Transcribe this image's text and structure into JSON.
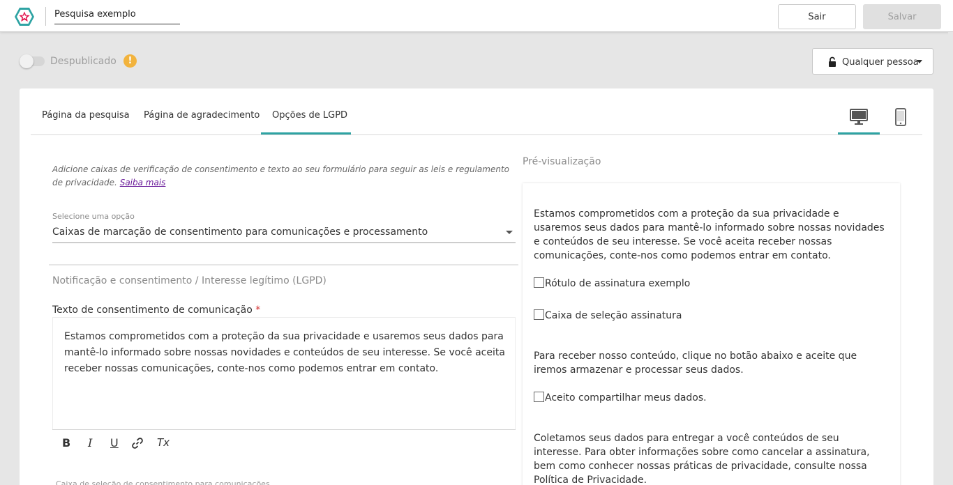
{
  "header": {
    "survey_title": "Pesquisa exemplo",
    "exit_label": "Sair",
    "save_label": "Salvar"
  },
  "status": {
    "publish_label": "Despublicado",
    "warning_glyph": "!",
    "access_label": "Qualquer pessoa"
  },
  "tabs": [
    {
      "label": "Página da pesquisa"
    },
    {
      "label": "Página de agradecimento"
    },
    {
      "label": "Opções de LGPD"
    }
  ],
  "active_tab": "Opções de LGPD",
  "devices": {
    "selected": "desktop-icon",
    "other": "mobile-icon"
  },
  "form": {
    "intro_text": "Adicione caixas de verificação de consentimento e texto ao seu formulário para seguir as leis e regulamento de privacidade.",
    "learn_more": "Saiba mais",
    "select_label": "Selecione uma opção",
    "select_value": "Caixas de marcação de consentimento para comunicações e processamento",
    "section_title": "Notificação e consentimento / Interesse legítimo (LGPD)",
    "consent_label": "Texto de consentimento de comunicação",
    "required_mark": "*",
    "consent_text": "Estamos comprometidos com a proteção da sua privacidade e usaremos seus dados para mantê-lo informado sobre nossas novidades e conteúdos de seu interesse. Se você aceita receber nossas comunicações, conte-nos como podemos entrar em contato.",
    "toolbar": {
      "bold": "B",
      "italic": "I",
      "underline": "U",
      "clear": "Tx"
    },
    "next_field_label": "Caixa de seleção de consentimento para comunicações"
  },
  "preview": {
    "title": "Pré-visualização",
    "paragraph1": "Estamos comprometidos com a proteção da sua privacidade e usaremos seus dados para mantê-lo informado sobre nossas novidades e conteúdos de seu interesse. Se você aceita receber nossas comunicações, conte-nos como podemos entrar em contato.",
    "checkbox1": "Rótulo de assinatura exemplo",
    "checkbox2": "Caixa de seleção assinatura",
    "paragraph2": "Para receber nosso conteúdo, clique no botão abaixo e aceite que iremos armazenar e processar seus dados.",
    "checkbox3": "Aceito compartilhar meus dados.",
    "paragraph3": "Coletamos seus dados para entregar a você conteúdos de seu interesse. Para obter informações sobre como cancelar a assinatura, bem como conhecer nossas práticas de privacidade, consulte nossa Política de Privacidade."
  },
  "colors": {
    "accent": "#2ea3a3",
    "warning": "#f2b33d",
    "link": "#6a1b9a",
    "logo": "#e3174f"
  }
}
